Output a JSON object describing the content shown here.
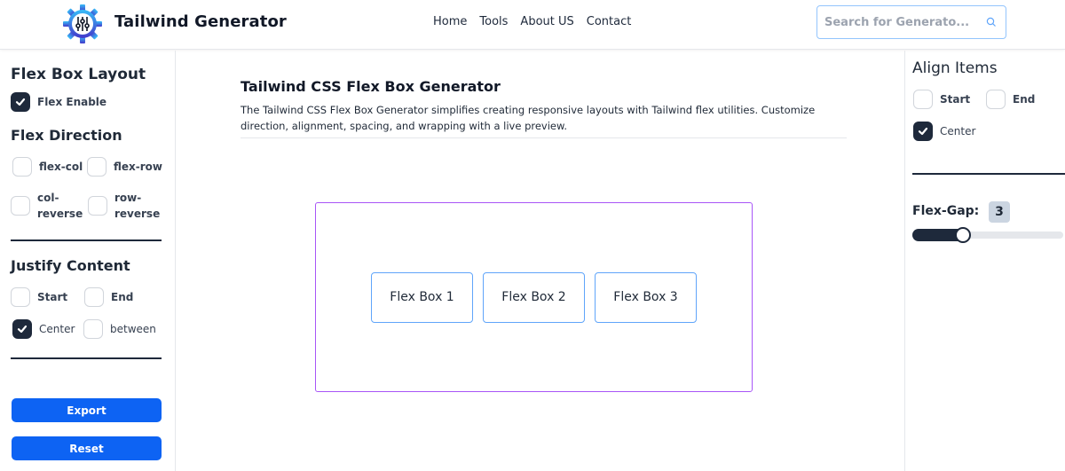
{
  "header": {
    "brand": "Tailwind Generator",
    "logo_icon": "gear-sliders-icon",
    "nav": [
      {
        "label": "Home"
      },
      {
        "label": "Tools"
      },
      {
        "label": "About US"
      },
      {
        "label": "Contact"
      }
    ],
    "search": {
      "placeholder": "Search for Generato...",
      "value": "",
      "icon": "search-icon"
    }
  },
  "left_panel": {
    "title": "Flex Box Layout",
    "flex_enable": {
      "label": "Flex Enable",
      "checked": true
    },
    "flex_direction": {
      "title": "Flex Direction",
      "options": [
        {
          "label": "flex-col",
          "checked": false
        },
        {
          "label": "flex-row",
          "checked": false
        },
        {
          "label": "col-reverse",
          "line1": "col-",
          "line2": "reverse",
          "checked": false
        },
        {
          "label": "row-reverse",
          "line1": "row-",
          "line2": "reverse",
          "checked": false
        }
      ]
    },
    "justify_content": {
      "title": "Justify Content",
      "options": [
        {
          "label": "Start",
          "checked": false
        },
        {
          "label": "End",
          "checked": false
        },
        {
          "label": "Center",
          "checked": true
        },
        {
          "label": "between",
          "checked": false
        }
      ]
    },
    "buttons": {
      "export": "Export",
      "reset": "Reset"
    }
  },
  "main": {
    "title": "Tailwind CSS Flex Box Generator",
    "description": "The Tailwind CSS Flex Box Generator simplifies creating responsive layouts with Tailwind flex utilities. Customize direction, alignment, spacing, and wrapping with a live preview.",
    "preview_boxes": [
      "Flex Box 1",
      "Flex Box 2",
      "Flex Box 3"
    ]
  },
  "right_panel": {
    "align_items": {
      "title": "Align Items",
      "options": [
        {
          "label": "Start",
          "checked": false
        },
        {
          "label": "End",
          "checked": false
        },
        {
          "label": "Center",
          "checked": true
        }
      ]
    },
    "flex_gap": {
      "label": "Flex-Gap:",
      "value": "3",
      "slider_fraction": 0.3
    }
  },
  "colors": {
    "primary_button": "#0d63f3",
    "checkbox_checked": "#1e293b",
    "preview_border": "#a855f7",
    "box_border": "#60a5fa"
  }
}
